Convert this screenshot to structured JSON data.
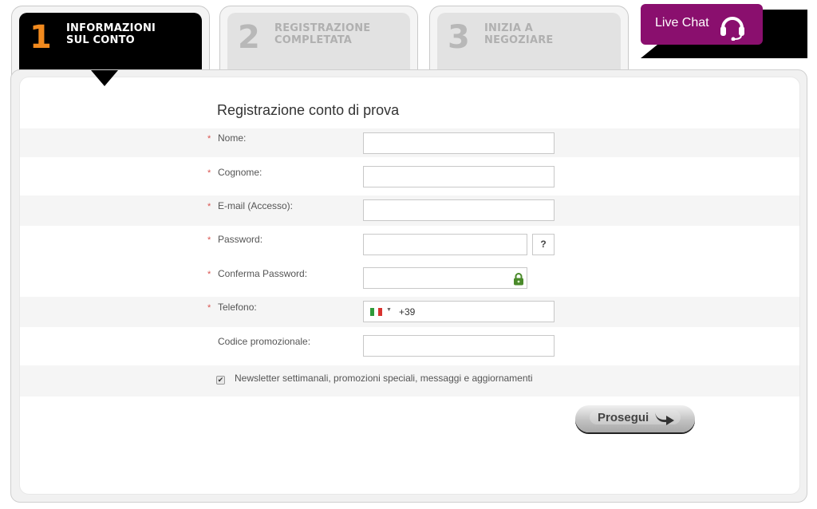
{
  "steps": [
    {
      "number": "1",
      "line1": "INFORMAZIONI",
      "line2": "SUL CONTO",
      "active": true
    },
    {
      "number": "2",
      "line1": "REGISTRAZIONE",
      "line2": "COMPLETATA",
      "active": false
    },
    {
      "number": "3",
      "line1": "INIZIA A",
      "line2": "NEGOZIARE",
      "active": false
    }
  ],
  "live_chat": {
    "label": "Live Chat",
    "icon": "headset-icon",
    "color": "#8a0f6e"
  },
  "form": {
    "title": "Registrazione conto di prova",
    "required_mark": "*",
    "fields": {
      "nome": {
        "label": "Nome:",
        "value": "",
        "required": true
      },
      "cognome": {
        "label": "Cognome:",
        "value": "",
        "required": true
      },
      "email": {
        "label": "E-mail (Accesso):",
        "value": "",
        "required": true
      },
      "password": {
        "label": "Password:",
        "value": "",
        "required": true,
        "help": "?"
      },
      "conferma": {
        "label": "Conferma Password:",
        "value": "",
        "required": true,
        "icon": "lock-icon"
      },
      "telefono": {
        "label": "Telefono:",
        "value": "+39",
        "required": true,
        "country": "IT"
      },
      "promo": {
        "label": "Codice promozionale:",
        "value": "",
        "required": false
      }
    },
    "newsletter": {
      "label": "Newsletter settimanali, promozioni speciali, messaggi e aggiornamenti",
      "checked": true,
      "check_glyph": "✔"
    },
    "submit_label": "Prosegui"
  }
}
